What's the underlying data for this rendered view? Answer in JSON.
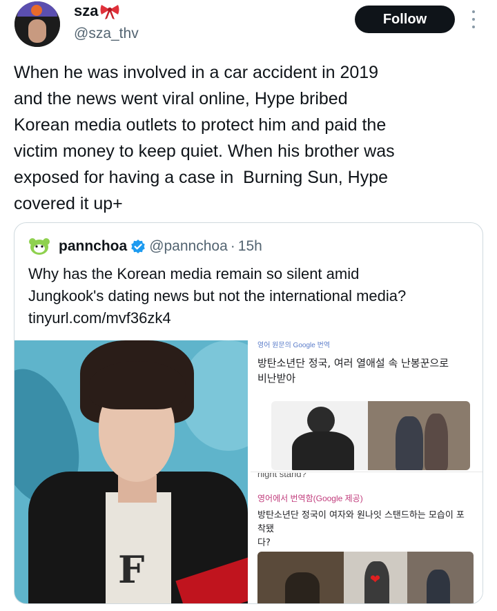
{
  "author": {
    "name": "sza",
    "handle": "@sza_thv",
    "name_emoji_icon": "ribbon-bow-icon"
  },
  "actions": {
    "follow_label": "Follow",
    "more_icon": "more-vertical-icon"
  },
  "tweet": {
    "text": "When he was involved in a car accident in 2019\nand the news went viral online, Hype bribed\nKorean media outlets to protect him and paid the\nvictim money to keep quiet. When his brother was\nexposed for having a case in  Burning Sun, Hype\ncovered it up+"
  },
  "quoted": {
    "name": "pannchoa",
    "handle": "@pannchoa",
    "separator": "·",
    "time": "15h",
    "verified_icon": "verified-badge-icon",
    "text": "Why has the Korean media remain so silent amid\nJungkook's dating news but not the international media?\ntinyurl.com/mvf36zk4"
  },
  "media": {
    "panel_top": {
      "strip": "영어 원문의 Google 번역",
      "headline": "방탄소년단 정국, 여러 열애설 속 난봉꾼으로\n비난받아"
    },
    "panel_bottom": {
      "strip": "night stand?",
      "label": "영어에서 번역함(Google 제공)",
      "headline": "방탄소년단 정국이 여자와 원나잇 스탠드하는 모습이 포착됐\n다?"
    }
  },
  "colors": {
    "follow_bg": "#0f1419",
    "verified": "#1d9bf0",
    "secondary_text": "#536471",
    "border": "#cfd9de"
  }
}
